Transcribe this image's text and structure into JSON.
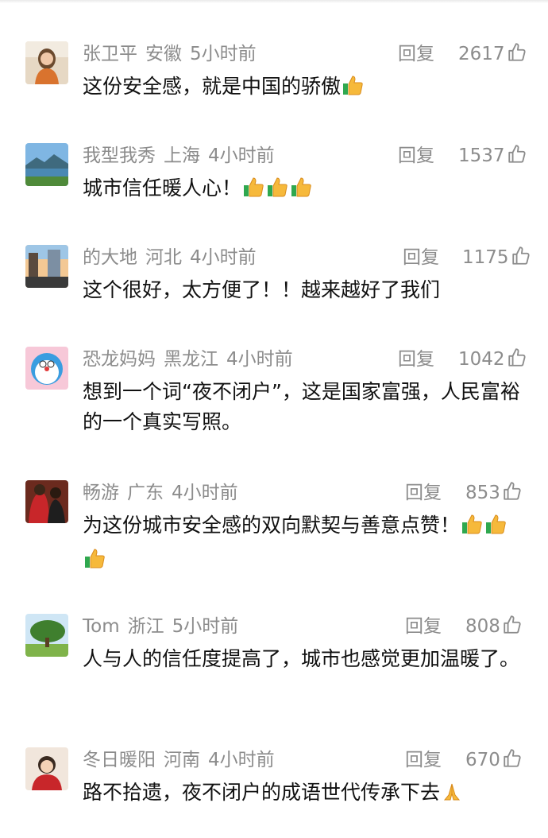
{
  "reply_label": "回复",
  "comments": [
    {
      "name": "张卫平",
      "location": "安徽",
      "time": "5小时前",
      "likes": "2617",
      "text": "这份安全感，就是中国的骄傲",
      "avatar": "avatar-woman-photo",
      "emoji": [
        "thumbs-up-emoji"
      ]
    },
    {
      "name": "我型我秀",
      "location": "上海",
      "time": "4小时前",
      "likes": "1537",
      "text": "城市信任暖人心！",
      "avatar": "avatar-lake-landscape",
      "emoji": [
        "thumbs-up-emoji",
        "thumbs-up-emoji",
        "thumbs-up-emoji"
      ]
    },
    {
      "name": "的大地",
      "location": "河北",
      "time": "4小时前",
      "likes": "1175",
      "text": "这个很好，太方便了！！越来越好了我们",
      "avatar": "avatar-city-sunset",
      "emoji": []
    },
    {
      "name": "恐龙妈妈",
      "location": "黑龙江",
      "time": "4小时前",
      "likes": "1042",
      "text": "想到一个词“夜不闭户”，这是国家富强，人民富裕的一个真实写照。",
      "avatar": "avatar-cartoon-doraemon",
      "emoji": []
    },
    {
      "name": "畅游",
      "location": "广东",
      "time": "4小时前",
      "likes": "853",
      "text": "为这份城市安全感的双向默契与善意点赞！",
      "avatar": "avatar-couple-red",
      "emoji": [
        "thumbs-up-emoji",
        "thumbs-up-emoji",
        "thumbs-up-emoji"
      ]
    },
    {
      "name": "Tom",
      "location": "浙江",
      "time": "5小时前",
      "likes": "808",
      "text": "人与人的信任度提高了，城市也感觉更加温暖了。",
      "avatar": "avatar-tree-landscape",
      "emoji": []
    },
    {
      "name": "冬日暖阳",
      "location": "河南",
      "time": "4小时前",
      "likes": "670",
      "text": "路不拾遗，夜不闭户的成语世代传承下去",
      "avatar": "avatar-girl-red-illustration",
      "emoji": [
        "folded-hands-emoji"
      ]
    }
  ]
}
